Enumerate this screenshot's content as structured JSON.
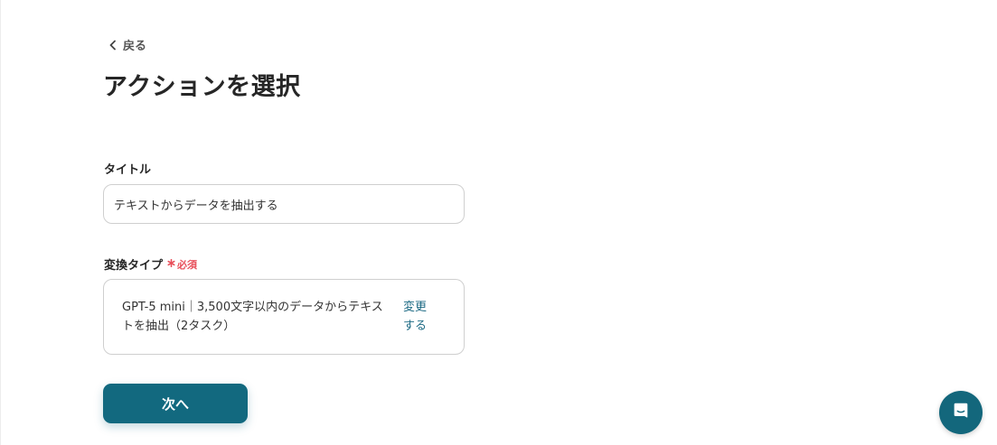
{
  "nav": {
    "back_label": "戻る"
  },
  "page": {
    "title": "アクションを選択"
  },
  "form": {
    "title_field": {
      "label": "タイトル",
      "value": "テキストからデータを抽出する"
    },
    "type_field": {
      "label": "変換タイプ",
      "required_label": "必須",
      "value": "GPT-5 mini｜3,500文字以内のデータからテキストを抽出（2タスク）",
      "change_label": "変更する"
    },
    "next_label": "次へ"
  },
  "colors": {
    "accent": "#12697f",
    "required": "#e8505b",
    "link": "#1d6a84"
  },
  "icons": {
    "back": "chevron-left-icon",
    "required": "asterisk-icon",
    "chat": "chat-icon"
  }
}
